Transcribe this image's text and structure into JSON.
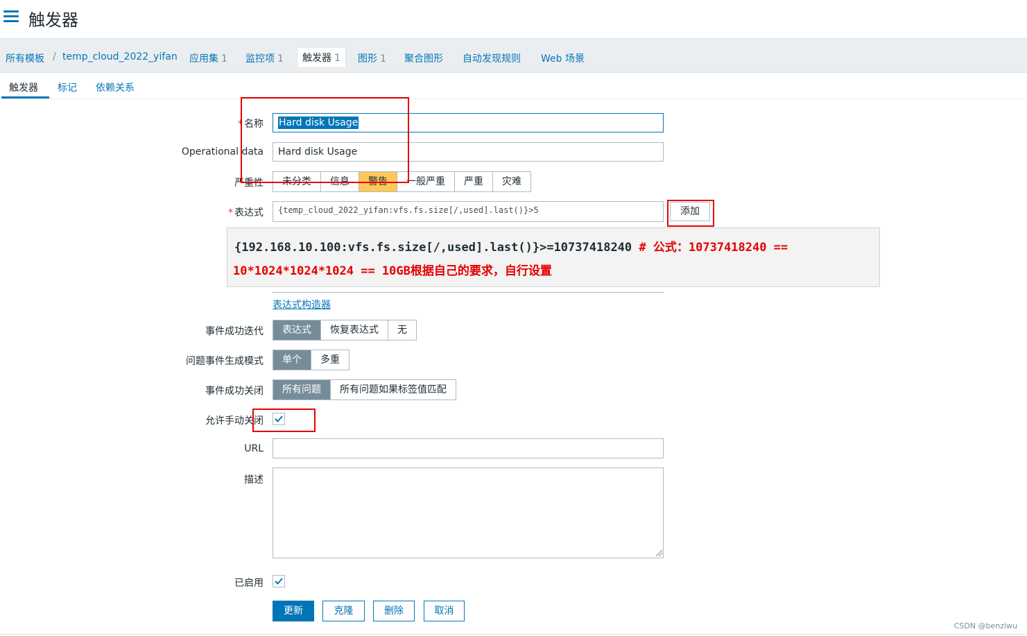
{
  "header": {
    "title": "触发器"
  },
  "breadcrumb": {
    "all_templates": "所有模板",
    "separator": "/",
    "template": "temp_cloud_2022_yifan",
    "items": [
      {
        "label": "应用集",
        "count": "1"
      },
      {
        "label": "监控项",
        "count": "1"
      },
      {
        "label": "触发器",
        "count": "1"
      },
      {
        "label": "图形",
        "count": "1"
      },
      {
        "label": "聚合图形",
        "count": ""
      },
      {
        "label": "自动发现规则",
        "count": ""
      },
      {
        "label": "Web 场景",
        "count": ""
      }
    ]
  },
  "tabs": [
    "触发器",
    "标记",
    "依赖关系"
  ],
  "form": {
    "name_label": "名称",
    "name_value": "Hard disk Usage",
    "opdata_label": "Operational data",
    "opdata_value": "Hard disk Usage",
    "severity_label": "严重性",
    "severity_options": [
      "未分类",
      "信息",
      "警告",
      "一般严重",
      "严重",
      "灾难"
    ],
    "severity_selected": "警告",
    "expression_label": "表达式",
    "expression_value": "{temp_cloud_2022_yifan:vfs.fs.size[/,used].last()}>5",
    "add_button": "添加",
    "expression_builder": "表达式构造器",
    "ok_event_label": "事件成功迭代",
    "ok_event_options": [
      "表达式",
      "恢复表达式",
      "无"
    ],
    "problem_mode_label": "问题事件生成模式",
    "problem_mode_options": [
      "单个",
      "多重"
    ],
    "ok_close_label": "事件成功关闭",
    "ok_close_options": [
      "所有问题",
      "所有问题如果标签值匹配"
    ],
    "manual_close_label": "允许手动关闭",
    "url_label": "URL",
    "url_value": "",
    "description_label": "描述",
    "description_value": "",
    "enabled_label": "已启用"
  },
  "annotation": {
    "line1_code": "{192.168.10.100:vfs.fs.size[/,used].last()}>=10737418240",
    "line1_comment": " # 公式：10737418240 ==",
    "line2": "10*1024*1024*1024 == 10GB根据自己的要求，自行设置"
  },
  "buttons": {
    "update": "更新",
    "clone": "克隆",
    "delete": "删除",
    "cancel": "取消"
  },
  "watermark": "CSDN @benziwu",
  "colors": {
    "accent": "#0275b8",
    "warning": "#ffc859",
    "highlight_box": "#e60000",
    "selected_segment": "#768d99"
  }
}
